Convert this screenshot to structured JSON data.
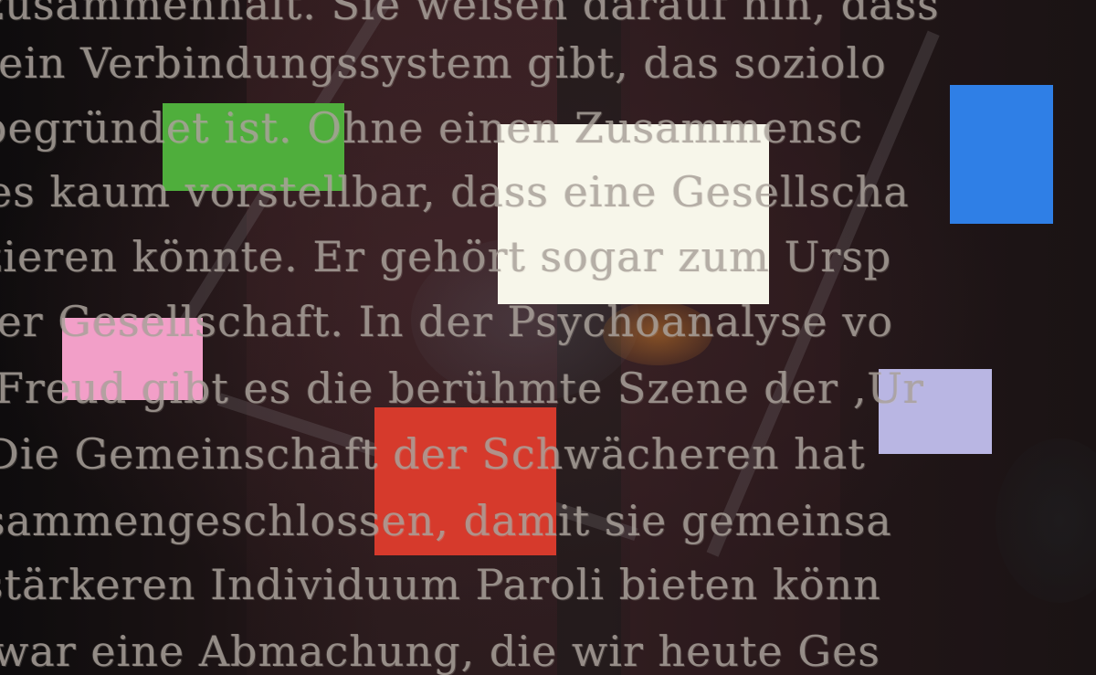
{
  "painting": {
    "text_lines": [
      "zusammenhält. Sie weisen darauf hin, dass",
      "ein Verbindungssystem gibt, das soziolo",
      "begründet ist. Ohne einen Zusammensc",
      "es kaum vorstellbar, dass eine Gesellscha",
      "zieren könnte. Er gehört sogar zum Ursp",
      "der Gesellschaft. In der Psychoanalyse vo",
      "Freud gibt es die berühmte Szene der ‚Ur",
      "Die Gemeinschaft der Schwächeren hat",
      "sammengeschlossen, damit sie gemeinsa",
      "stärkeren Individuum Paroli bieten könn",
      "war eine Abmachung, die wir heute Ges"
    ],
    "colors": {
      "background": "#1c1416",
      "green_block": "#4fae3c",
      "cream_block": "#f7f6ea",
      "blue_block": "#2f7fe6",
      "pink_block": "#f29fc8",
      "red_block": "#d63a2c",
      "lavender_block": "#b9b6e3",
      "text": "#aaa29b"
    }
  }
}
